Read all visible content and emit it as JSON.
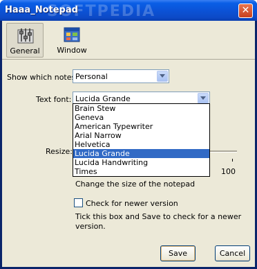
{
  "window": {
    "title": "Haaa_Notepad",
    "close_glyph": "✕"
  },
  "watermark": "SOFTPEDIA",
  "toolbar": {
    "items": [
      {
        "label": "General",
        "icon": "general-settings-icon",
        "selected": true
      },
      {
        "label": "Window",
        "icon": "window-icon",
        "selected": false
      }
    ]
  },
  "form": {
    "show_notes": {
      "label": "Show which notes:",
      "value": "Personal"
    },
    "text_font": {
      "label": "Text font:",
      "value": "Lucida Grande",
      "options": [
        "Brain Stew",
        "Geneva",
        "American Typewriter",
        "Arial Narrow",
        "Helvetica",
        "Lucida Grande",
        "Lucida Handwriting",
        "Times"
      ],
      "selected": "Lucida Grande"
    },
    "resize": {
      "label": "Resize:",
      "tick_max": "100",
      "hint": "Change the size of the notepad"
    },
    "check_updates": {
      "label": "Check for newer version",
      "checked": false,
      "hint_line1": "Tick this box and Save to check for a newer",
      "hint_line2": "version."
    }
  },
  "buttons": {
    "save": "Save",
    "cancel": "Cancel"
  },
  "colors": {
    "titlebar": "#0b53d7",
    "client_bg": "#ece9d8",
    "selection": "#316ac5"
  }
}
